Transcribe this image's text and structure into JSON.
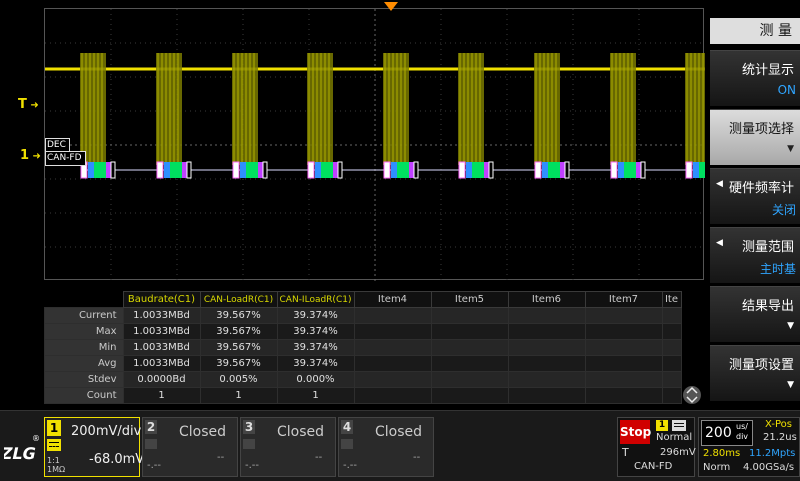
{
  "markers": {
    "trigger": "T",
    "channel1": "1"
  },
  "decode": {
    "dec_label": "DEC",
    "proto_label": "CAN-FD"
  },
  "menu": {
    "title": "测 量",
    "items": [
      {
        "label": "统计显示",
        "value": "ON"
      },
      {
        "label": "测量项选择",
        "value": ""
      },
      {
        "label": "硬件频率计",
        "value": "关闭"
      },
      {
        "label": "测量范围",
        "value": "主时基"
      },
      {
        "label": "结果导出",
        "value": ""
      },
      {
        "label": "测量项设置",
        "value": ""
      }
    ]
  },
  "table": {
    "headers": [
      "Baudrate(C1)",
      "CAN-LoadR(C1)",
      "CAN-ILoadR(C1)",
      "Item4",
      "Item5",
      "Item6",
      "Item7",
      "Ite"
    ],
    "rows": [
      {
        "label": "Current",
        "values": [
          "1.0033MBd",
          "39.567%",
          "39.374%"
        ]
      },
      {
        "label": "Max",
        "values": [
          "1.0033MBd",
          "39.567%",
          "39.374%"
        ]
      },
      {
        "label": "Min",
        "values": [
          "1.0033MBd",
          "39.567%",
          "39.374%"
        ]
      },
      {
        "label": "Avg",
        "values": [
          "1.0033MBd",
          "39.567%",
          "39.374%"
        ]
      },
      {
        "label": "Stdev",
        "values": [
          "0.0000Bd",
          "0.005%",
          "0.000%"
        ]
      },
      {
        "label": "Count",
        "values": [
          "1",
          "1",
          "1"
        ]
      }
    ]
  },
  "channels": {
    "ch1": {
      "num": "1",
      "scale": "200mV/div",
      "offset": "-68.0mV",
      "coupling": "1:1",
      "impedance": "1MΩ"
    },
    "ch2": {
      "num": "2",
      "status": "Closed",
      "a": "-.--",
      "b": "--"
    },
    "ch3": {
      "num": "3",
      "status": "Closed",
      "a": "-.--",
      "b": "--"
    },
    "ch4": {
      "num": "4",
      "status": "Closed",
      "a": "-.--",
      "b": "--"
    }
  },
  "status": {
    "run_state": "Stop",
    "trigger_mode": "Normal",
    "trigger_source": "1",
    "trigger_label": "T",
    "trigger_level": "296mV",
    "decode_proto": "CAN-FD",
    "timebase_value": "200",
    "timebase_unit_top": "us/",
    "timebase_unit_bottom": "div",
    "xpos_label": "X-Pos",
    "xpos_value": "21.2us",
    "freq": "2.80ms",
    "mem_depth": "11.2Mpts",
    "acq_mode": "Norm",
    "sample_rate": "4.00GSa/s"
  },
  "colors": {
    "ch1": "#f0e000",
    "accent": "#2fa5ff",
    "stop": "#d00000"
  }
}
